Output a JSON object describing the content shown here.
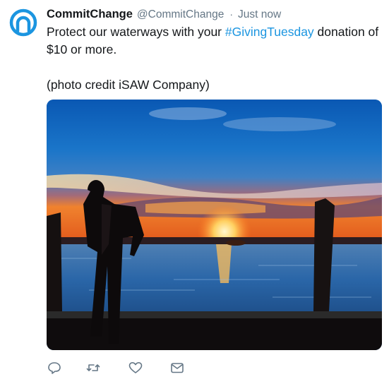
{
  "tweet": {
    "author_name": "CommitChange",
    "author_handle": "@CommitChange",
    "separator": "·",
    "timestamp": "Just now",
    "text_before_hashtag": "Protect our waterways with your ",
    "hashtag": "#GivingTuesday",
    "text_after_hashtag": " donation of $10 or more.",
    "credit": "(photo credit iSAW Company)"
  },
  "colors": {
    "brand": "#1b95e0",
    "text": "#14171a",
    "muted": "#657786"
  },
  "icons": {
    "avatar": "commitchange-logo-icon",
    "reply": "reply-icon",
    "retweet": "retweet-icon",
    "like": "heart-icon",
    "message": "envelope-icon"
  }
}
